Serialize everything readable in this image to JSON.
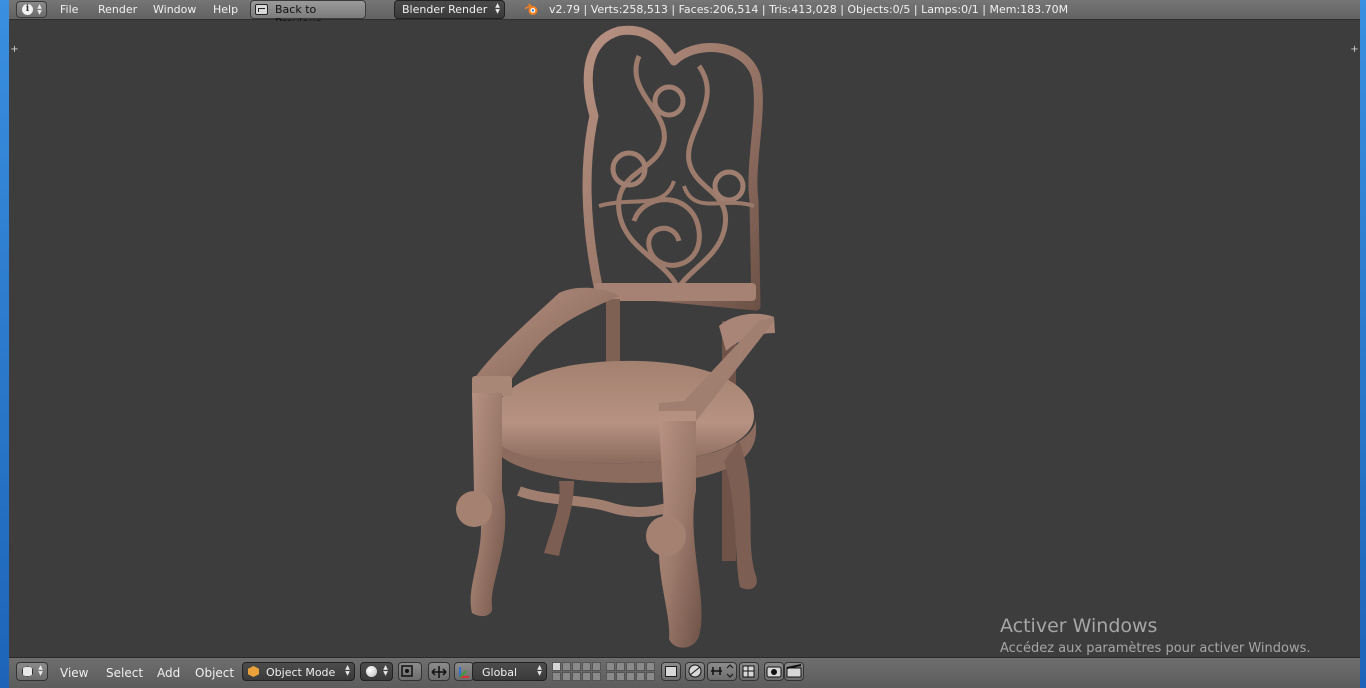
{
  "top_header": {
    "menus": [
      "File",
      "Render",
      "Window",
      "Help"
    ],
    "back_button_label": "Back to Previous",
    "render_engine": "Blender Render",
    "stats": "v2.79 | Verts:258,513 | Faces:206,514 | Tris:413,028 | Objects:0/5 | Lamps:0/1 | Mem:183.70M"
  },
  "viewport": {
    "object": "carved-wooden-armchair",
    "background_color": "#3d3d3d",
    "material_color": "#9d7b6d"
  },
  "watermark": {
    "title": "Activer Windows",
    "subtitle": "Accédez aux paramètres pour activer Windows."
  },
  "bottom_header": {
    "menus": [
      "View",
      "Select",
      "Add",
      "Object"
    ],
    "mode": "Object Mode",
    "orientation": "Global"
  },
  "icons": {
    "info": "info-icon",
    "blender": "blender-logo-icon",
    "editor_type": "3d-view-icon",
    "mode": "object-mode-cube-icon",
    "shading": "solid-shading-sphere-icon",
    "pivot": "pivot-point-icon",
    "manipulator": "manipulator-icon",
    "orientation": "transform-orientation-icon",
    "layers": "layer-grid-icon",
    "lock": "layer-lock-icon",
    "proportional": "proportional-edit-icon",
    "snap": "snap-icon",
    "render_preview": "opengl-render-icon",
    "render_anim": "opengl-animation-icon"
  }
}
